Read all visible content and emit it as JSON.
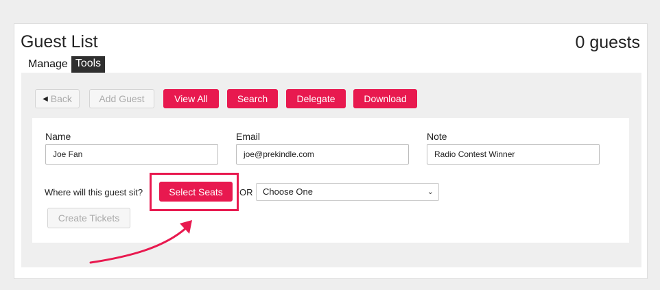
{
  "header": {
    "title": "Guest List",
    "guest_count": "0 guests"
  },
  "tabs": [
    {
      "label": "Manage",
      "active": false
    },
    {
      "label": "Tools",
      "active": true
    }
  ],
  "toolbar": {
    "back_label": "Back",
    "add_guest_label": "Add Guest",
    "view_all_label": "View All",
    "search_label": "Search",
    "delegate_label": "Delegate",
    "download_label": "Download"
  },
  "form": {
    "name": {
      "label": "Name",
      "value": "Joe Fan"
    },
    "email": {
      "label": "Email",
      "value": "joe@prekindle.com"
    },
    "note": {
      "label": "Note",
      "value": "Radio Contest Winner"
    },
    "sit_question": "Where will this guest sit?",
    "select_seats_label": "Select Seats",
    "or_label": "OR",
    "seat_option_selected": "Choose One",
    "create_tickets_label": "Create Tickets"
  },
  "colors": {
    "accent": "#e8194f",
    "tab_active_bg": "#2f2f2f",
    "panel_bg": "#efefef"
  }
}
